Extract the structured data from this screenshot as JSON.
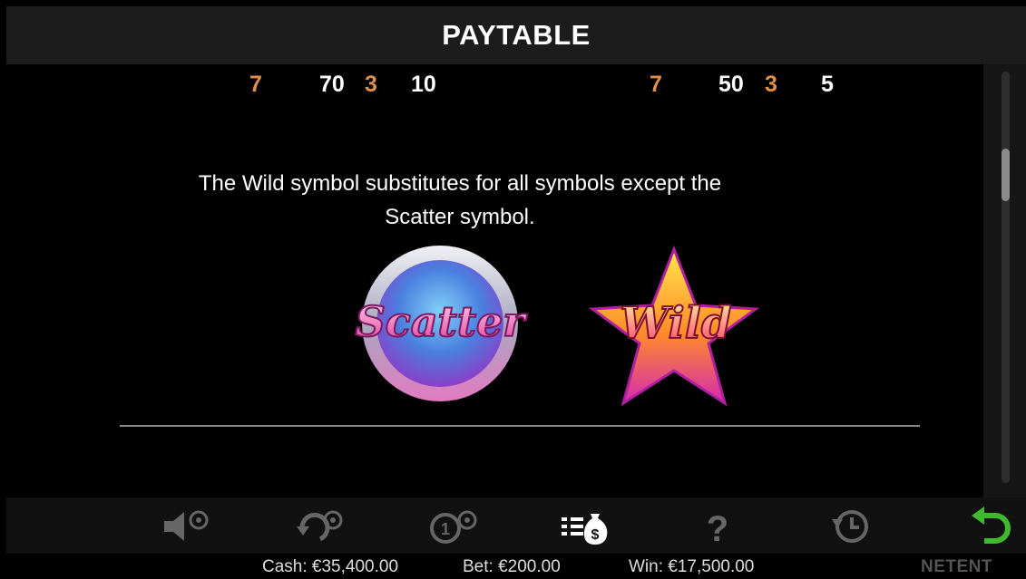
{
  "header": {
    "title": "PAYTABLE"
  },
  "paytable": {
    "left": {
      "count_a": "7",
      "value_a": "70",
      "count_b": "3",
      "value_b": "10"
    },
    "right": {
      "count_a": "7",
      "value_a": "50",
      "count_b": "3",
      "value_b": "5"
    }
  },
  "description": "The Wild symbol substitutes for all symbols except the Scatter symbol.",
  "symbols": {
    "scatter": {
      "label": "Scatter"
    },
    "wild": {
      "label": "Wild"
    }
  },
  "toolbar": {
    "buttons": [
      {
        "name": "sound-settings-icon"
      },
      {
        "name": "autoplay-settings-icon"
      },
      {
        "name": "coin-settings-icon"
      },
      {
        "name": "paytable-icon",
        "active": true
      },
      {
        "name": "help-icon"
      },
      {
        "name": "history-icon"
      },
      {
        "name": "back-icon"
      }
    ],
    "accent": "#3dbb2c"
  },
  "status": {
    "cash": "Cash: €35,400.00",
    "bet": "Bet: €200.00",
    "win": "Win: €17,500.00",
    "brand": "NETENT"
  }
}
